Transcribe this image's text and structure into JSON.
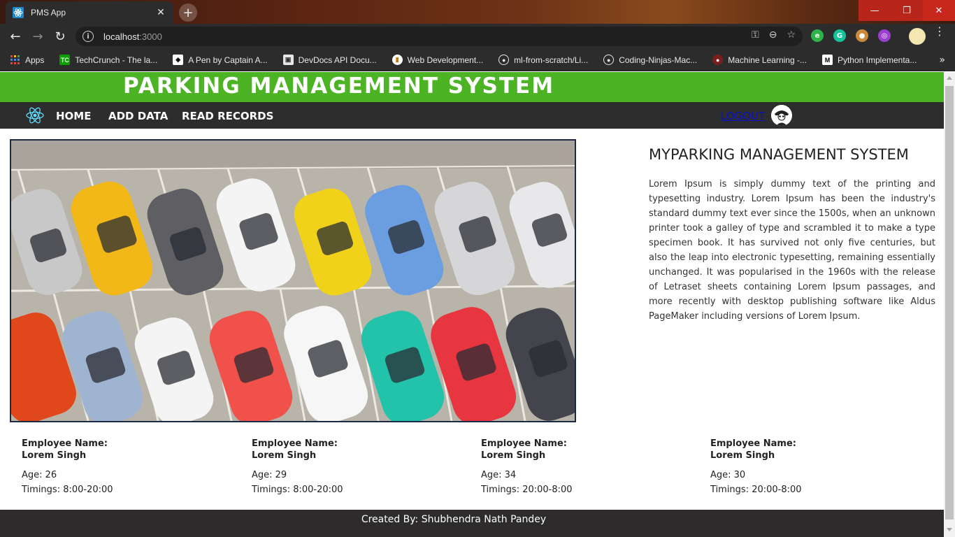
{
  "browser": {
    "tab_title": "PMS App",
    "url_host": "localhost",
    "url_port": ":3000",
    "bookmarks": [
      {
        "label": "Apps",
        "icon": "apps-grid-icon"
      },
      {
        "label": "TechCrunch - The la...",
        "icon": "techcrunch-icon"
      },
      {
        "label": "A Pen by Captain A...",
        "icon": "codepen-icon"
      },
      {
        "label": "DevDocs API Docu...",
        "icon": "devdocs-icon"
      },
      {
        "label": "Web Development...",
        "icon": "web-dev-icon"
      },
      {
        "label": "ml-from-scratch/Li...",
        "icon": "github-icon"
      },
      {
        "label": "Coding-Ninjas-Mac...",
        "icon": "github-icon"
      },
      {
        "label": "Machine Learning -...",
        "icon": "ml-icon"
      },
      {
        "label": "Python Implementa...",
        "icon": "medium-icon"
      }
    ]
  },
  "site": {
    "banner_title": "PARKING MANAGEMENT SYSTEM",
    "nav": {
      "home": "HOME",
      "add_data": "ADD DATA",
      "read_records": "READ RECORDS",
      "logout": "LOGOUT"
    },
    "info": {
      "title": "MYPARKING MANAGEMENT SYSTEM",
      "text": "Lorem Ipsum is simply dummy text of the printing and typesetting industry. Lorem Ipsum has been the industry's standard dummy text ever since the 1500s, when an unknown printer took a galley of type and scrambled it to make a type specimen book. It has survived not only five centuries, but also the leap into electronic typesetting, remaining essentially unchanged. It was popularised in the 1960s with the release of Letraset sheets containing Lorem Ipsum passages, and more recently with desktop publishing software like Aldus PageMaker including versions of Lorem Ipsum."
    },
    "employees": [
      {
        "label": "Employee Name:",
        "name": "Lorem Singh",
        "age": "Age: 26",
        "timings": "Timings: 8:00-20:00"
      },
      {
        "label": "Employee Name:",
        "name": "Lorem Singh",
        "age": "Age: 29",
        "timings": "Timings: 8:00-20:00"
      },
      {
        "label": "Employee Name:",
        "name": "Lorem Singh",
        "age": "Age: 34",
        "timings": "Timings: 20:00-8:00"
      },
      {
        "label": "Employee Name:",
        "name": "Lorem Singh",
        "age": "Age: 30",
        "timings": "Timings: 20:00-8:00"
      }
    ],
    "footer": "Created By: Shubhendra Nath Pandey"
  },
  "colors": {
    "banner": "#4cb424",
    "navbar": "#2d2d2d",
    "logout": "#0a12c8",
    "footer": "#2d2b2b"
  }
}
